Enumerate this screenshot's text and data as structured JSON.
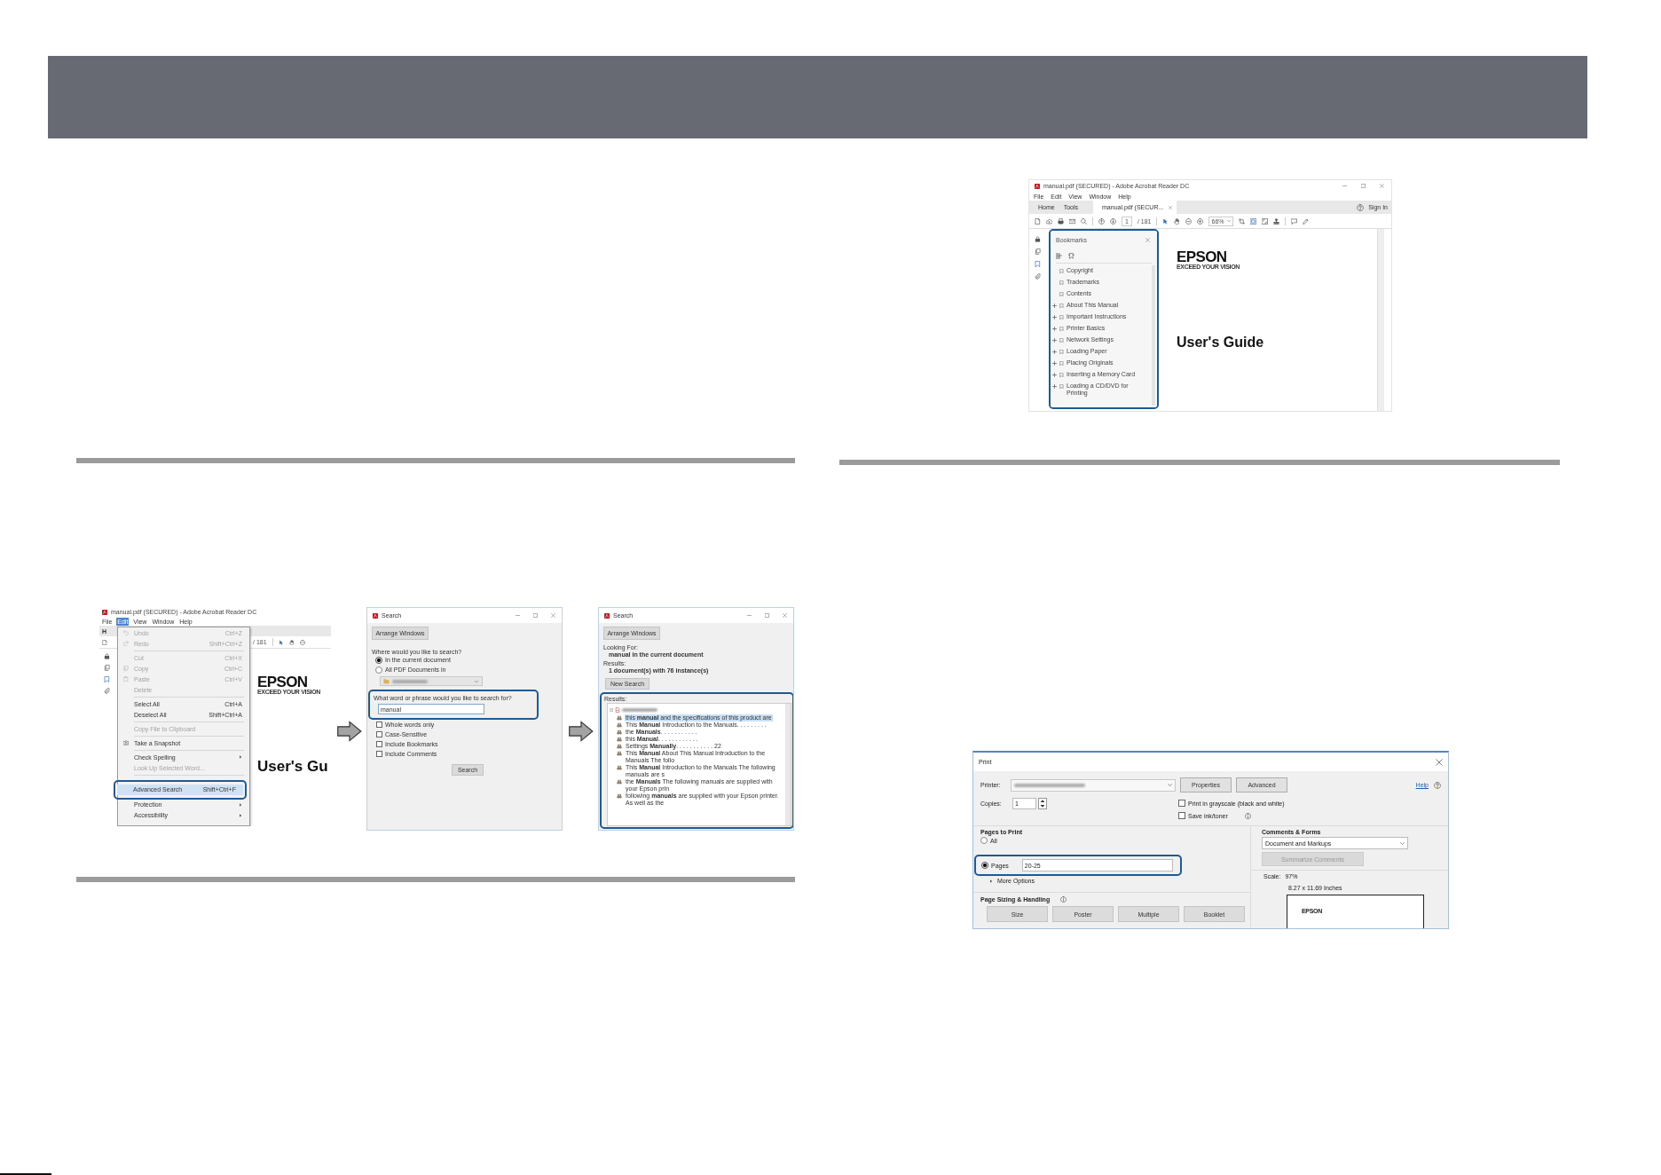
{
  "bookmarks_figure": {
    "window": {
      "title": "manual.pdf (SECURED) - Adobe Acrobat Reader DC",
      "menu": [
        {
          "label": "File",
          "selected": false
        },
        {
          "label": "Edit",
          "selected": false
        },
        {
          "label": "View",
          "selected": false
        },
        {
          "label": "Window",
          "selected": false
        },
        {
          "label": "Help",
          "selected": false
        }
      ],
      "tabs": [
        {
          "label": "Home",
          "selected": false
        },
        {
          "label": "Tools",
          "selected": false
        },
        {
          "label": "manual.pdf (SECUR...",
          "selected": true
        }
      ],
      "sign_in": "Sign In",
      "page_number": "1",
      "page_total": "/ 181",
      "zoom_value": "66%"
    },
    "bookmarks_panel": {
      "title": "Bookmarks",
      "items": [
        {
          "label": "Copyright",
          "expandable": false
        },
        {
          "label": "Trademarks",
          "expandable": false
        },
        {
          "label": "Contents",
          "expandable": false
        },
        {
          "label": "About This Manual",
          "expandable": true
        },
        {
          "label": "Important Instructions",
          "expandable": true
        },
        {
          "label": "Printer Basics",
          "expandable": true
        },
        {
          "label": "Network Settings",
          "expandable": true
        },
        {
          "label": "Loading Paper",
          "expandable": true
        },
        {
          "label": "Placing Originals",
          "expandable": true
        },
        {
          "label": "Inserting a Memory Card",
          "expandable": true
        },
        {
          "label": "Loading a CD/DVD for Printing",
          "expandable": true
        }
      ]
    },
    "document": {
      "logo": "EPSON",
      "tagline": "EXCEED YOUR VISION",
      "title": "User's Guide"
    }
  },
  "search_steps": [
    {
      "kind": "edit_menu",
      "window": {
        "title": "manual.pdf (SECURED) - Adobe Acrobat Reader DC",
        "menu": [
          {
            "label": "File",
            "selected": false
          },
          {
            "label": "Edit",
            "selected": true
          },
          {
            "label": "View",
            "selected": false
          },
          {
            "label": "Window",
            "selected": false
          },
          {
            "label": "Help",
            "selected": false
          }
        ],
        "tabs": [
          {
            "label": "H",
            "selected": false
          }
        ],
        "page_total": "/ 181"
      },
      "menu_groups": [
        [
          {
            "label": "Undo",
            "shortcut": "Ctrl+Z",
            "enabled": false,
            "submenu": false,
            "selected": false
          },
          {
            "label": "Redo",
            "shortcut": "Shift+Ctrl+Z",
            "enabled": false,
            "submenu": false,
            "selected": false
          }
        ],
        [
          {
            "label": "Cut",
            "shortcut": "Ctrl+X",
            "enabled": false,
            "submenu": false,
            "selected": false
          },
          {
            "label": "Copy",
            "shortcut": "Ctrl+C",
            "enabled": false,
            "submenu": false,
            "selected": false
          },
          {
            "label": "Paste",
            "shortcut": "Ctrl+V",
            "enabled": false,
            "submenu": false,
            "selected": false
          },
          {
            "label": "Delete",
            "enabled": false,
            "submenu": false,
            "selected": false
          }
        ],
        [
          {
            "label": "Select All",
            "shortcut": "Ctrl+A",
            "enabled": true,
            "submenu": false,
            "selected": false
          },
          {
            "label": "Deselect All",
            "shortcut": "Shift+Ctrl+A",
            "enabled": true,
            "submenu": false,
            "selected": false
          }
        ],
        [
          {
            "label": "Copy File to Clipboard",
            "enabled": false,
            "submenu": false,
            "selected": false
          }
        ],
        [
          {
            "label": "Take a Snapshot",
            "enabled": true,
            "submenu": false,
            "selected": false
          }
        ],
        [
          {
            "label": "Check Spelling",
            "enabled": true,
            "submenu": true,
            "selected": false
          },
          {
            "label": "Look Up Selected Word...",
            "enabled": false,
            "submenu": false,
            "selected": false
          }
        ],
        [
          {
            "label": "Advanced Search",
            "shortcut": "Shift+Ctrl+F",
            "enabled": true,
            "submenu": false,
            "selected": true
          },
          {
            "label": "Protection",
            "enabled": true,
            "submenu": true,
            "selected": false
          },
          {
            "label": "Accessibility",
            "enabled": true,
            "submenu": true,
            "selected": false
          }
        ]
      ],
      "document": {
        "logo": "EPSON",
        "tagline": "EXCEED YOUR VISION",
        "title": "User's Gu"
      }
    },
    {
      "kind": "search_dialog",
      "title": "Search",
      "arrange_button": "Arrange Windows",
      "where_label": "Where would you like to search?",
      "scope_options": [
        {
          "label": "In the current document",
          "selected": true
        },
        {
          "label": "All PDF Documents in",
          "selected": false
        }
      ],
      "phrase_label": "What word or phrase would you like to search for?",
      "phrase_value": "manual",
      "options": [
        {
          "label": "Whole words only",
          "checked": false
        },
        {
          "label": "Case-Sensitive",
          "checked": false
        },
        {
          "label": "Include Bookmarks",
          "checked": false
        },
        {
          "label": "Include Comments",
          "checked": false
        }
      ],
      "search_button": "Search"
    },
    {
      "kind": "results_dialog",
      "title": "Search",
      "arrange_button": "Arrange Windows",
      "looking_for_label": "Looking For:",
      "looking_for": "manual in the current document",
      "results_label": "Results:",
      "results_summary": "1 document(s) with 76 instance(s)",
      "new_search_button": "New Search",
      "results_group_label": "Results:",
      "results": [
        {
          "text": "this **manual** and the specifications of this product are",
          "selected": true
        },
        {
          "text": "This **Manual** Introduction to the Manuals. . . . . . . . .",
          "selected": false
        },
        {
          "text": "the **Manuals**. . . . . . . . . . .",
          "selected": false
        },
        {
          "text": "this **Manual**. . . . . . . . . . . .",
          "selected": false
        },
        {
          "text": "Settings **Manually**. . . . . . . . . . . 22",
          "selected": false
        },
        {
          "text": "This **Manual** About This Manual Introduction to the Manuals The follo",
          "selected": false
        },
        {
          "text": "This **Manual** Introduction to the Manuals The following manuals are s",
          "selected": false
        },
        {
          "text": "the **Manuals** The following manuals are supplied with your Epson prin",
          "selected": false
        },
        {
          "text": "following **manuals** are supplied with your Epson printer. As well as the",
          "selected": false
        }
      ]
    }
  ],
  "print_dialog": {
    "title": "Print",
    "printer_label": "Printer:",
    "buttons": [
      "Properties",
      "Advanced"
    ],
    "help_link": "Help",
    "copies": {
      "label": "Copies:",
      "value": "1"
    },
    "print_options": [
      {
        "label": "Print in grayscale (black and white)",
        "checked": false
      },
      {
        "label": "Save ink/toner",
        "checked": false
      }
    ],
    "pages_to_print": {
      "title": "Pages to Print",
      "options": [
        {
          "label": "All",
          "selected": false
        },
        {
          "label": "Pages",
          "selected": true,
          "value": "20-25"
        }
      ],
      "more_options": "More Options"
    },
    "page_sizing": {
      "title": "Page Sizing & Handling",
      "buttons": [
        "Size",
        "Poster",
        "Multiple",
        "Booklet"
      ]
    },
    "comments_forms": {
      "title": "Comments & Forms",
      "value": "Document and Markups",
      "summarize_button": {
        "label": "Summarize Comments",
        "enabled": false
      }
    },
    "preview": {
      "scale_label": "Scale:",
      "scale_value": "97%",
      "paper_size": "8.27 x 11.69 Inches",
      "logo": "EPSON"
    }
  }
}
